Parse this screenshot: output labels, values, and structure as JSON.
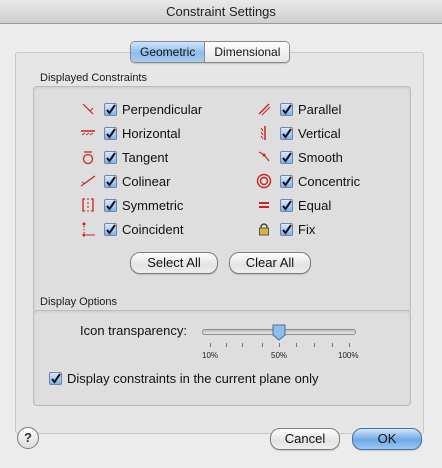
{
  "window": {
    "title": "Constraint Settings"
  },
  "tabs": [
    {
      "label": "Geometric",
      "active": true
    },
    {
      "label": "Dimensional",
      "active": false
    }
  ],
  "displayed_constraints": {
    "label": "Displayed Constraints",
    "left": [
      {
        "label": "Perpendicular",
        "checked": true,
        "icon": "perpendicular-icon"
      },
      {
        "label": "Horizontal",
        "checked": true,
        "icon": "horizontal-icon"
      },
      {
        "label": "Tangent",
        "checked": true,
        "icon": "tangent-icon"
      },
      {
        "label": "Colinear",
        "checked": true,
        "icon": "colinear-icon"
      },
      {
        "label": "Symmetric",
        "checked": true,
        "icon": "symmetric-icon"
      },
      {
        "label": "Coincident",
        "checked": true,
        "icon": "coincident-icon"
      }
    ],
    "right": [
      {
        "label": "Parallel",
        "checked": true,
        "icon": "parallel-icon"
      },
      {
        "label": "Vertical",
        "checked": true,
        "icon": "vertical-icon"
      },
      {
        "label": "Smooth",
        "checked": true,
        "icon": "smooth-icon"
      },
      {
        "label": "Concentric",
        "checked": true,
        "icon": "concentric-icon"
      },
      {
        "label": "Equal",
        "checked": true,
        "icon": "equal-icon"
      },
      {
        "label": "Fix",
        "checked": true,
        "icon": "lock-icon"
      }
    ],
    "select_all": "Select All",
    "clear_all": "Clear All"
  },
  "display_options": {
    "label": "Display Options",
    "transparency_label": "Icon transparency:",
    "transparency_value": 50,
    "tick_labels": [
      "10%",
      "50%",
      "100%"
    ],
    "current_plane_label": "Display constraints in the current plane only",
    "current_plane_checked": true
  },
  "buttons": {
    "help": "?",
    "cancel": "Cancel",
    "ok": "OK"
  },
  "colors": {
    "constraint_icon": "#cc2222",
    "accent": "#7fb1e6"
  }
}
